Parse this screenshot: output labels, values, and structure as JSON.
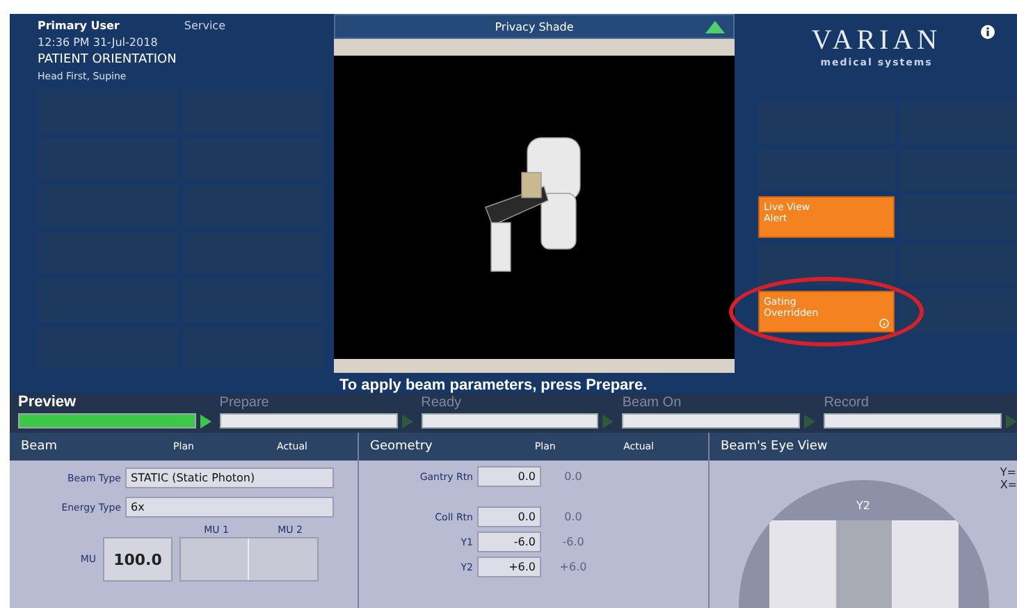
{
  "header": {
    "user": "Primary User",
    "mode": "Service",
    "datetime": "12:36 PM 31-Jul-2018",
    "section_title": "PATIENT ORIENTATION",
    "orientation": "Head First, Supine"
  },
  "logo": {
    "name": "VARIAN",
    "tagline": "medical systems"
  },
  "video": {
    "title": "Privacy Shade"
  },
  "message": "To apply beam parameters, press Prepare.",
  "alerts": [
    {
      "lines": [
        "Live View",
        "Alert"
      ],
      "info": false
    },
    {
      "lines": [
        "Gating",
        "Overridden"
      ],
      "info": true
    }
  ],
  "workflow": [
    {
      "label": "Preview",
      "selected": true,
      "level": 1
    },
    {
      "label": "Prepare",
      "selected": false,
      "level": 0
    },
    {
      "label": "Ready",
      "selected": false,
      "level": 0
    },
    {
      "label": "Beam On",
      "selected": false,
      "level": 0
    },
    {
      "label": "Record",
      "selected": false,
      "level": 0
    }
  ],
  "beam": {
    "title": "Beam",
    "columns": [
      "Plan",
      "Actual"
    ],
    "fields": [
      {
        "label": "Beam Type",
        "value": "STATIC (Static Photon)"
      },
      {
        "label": "Energy Type",
        "value": "6x"
      }
    ],
    "mu": {
      "label": "MU",
      "value": "100.0",
      "columns": [
        "MU 1",
        "MU 2"
      ]
    }
  },
  "geometry": {
    "title": "Geometry",
    "columns": [
      "Plan",
      "Actual"
    ],
    "rows": [
      {
        "label": "Gantry Rtn",
        "plan": "0.0",
        "actual": "0.0"
      },
      {
        "label": "Coll Rtn",
        "plan": "0.0",
        "actual": "0.0"
      },
      {
        "label": "Y1",
        "plan": "-6.0",
        "actual": "-6.0"
      },
      {
        "label": "Y2",
        "plan": "+6.0",
        "actual": "+6.0"
      }
    ]
  },
  "bev": {
    "title": "Beam's Eye View",
    "jaw_label": "Y2",
    "readouts": [
      "Y=",
      "X="
    ]
  }
}
